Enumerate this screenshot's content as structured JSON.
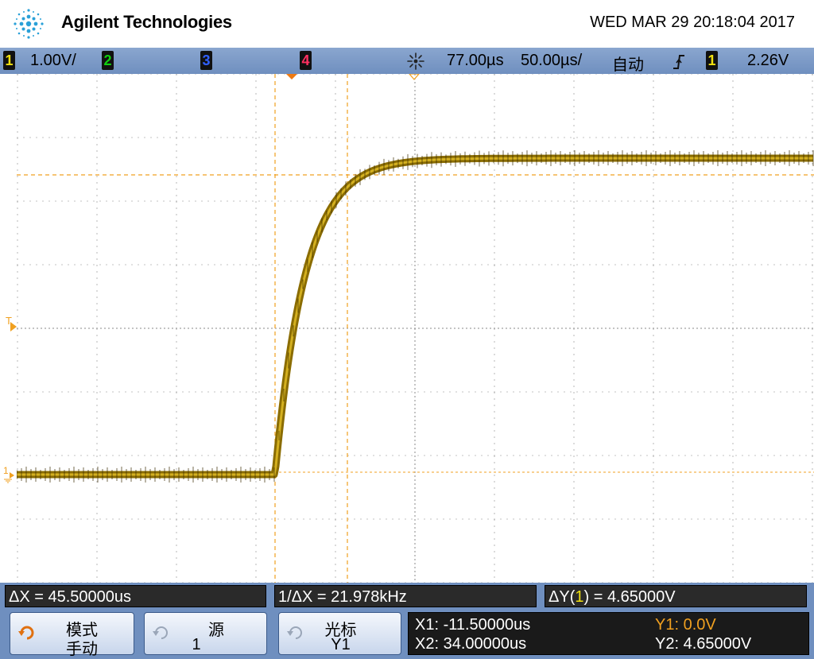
{
  "header": {
    "brand": "Agilent Technologies",
    "datetime": "WED MAR 29 20:18:04 2017",
    "logo_icon": "agilent-spark-logo"
  },
  "topbar": {
    "ch1": {
      "num": "1",
      "scale": "1.00V/",
      "color": "#f0e010"
    },
    "ch2": {
      "num": "2",
      "color": "#10d010"
    },
    "ch3": {
      "num": "3",
      "color": "#3060ff"
    },
    "ch4": {
      "num": "4",
      "color": "#ff3060"
    },
    "timebase_icon": "timebase-spark-icon",
    "delay": "77.00µs",
    "timescale": "50.00µs/",
    "mode": "自动",
    "trigger_icon": "rising-edge-icon",
    "trig_source": "1",
    "trig_level": "2.26V"
  },
  "screen": {
    "trigger_marker": "T",
    "ground_marker": "1",
    "trace_color": "#8a6c00",
    "grid_color": "#888888",
    "cursor_color": "#f0a020"
  },
  "measurements": {
    "dx": "ΔX = 45.50000us",
    "inv_dx": "1/ΔX = 21.978kHz",
    "dy_prefix": "ΔY(",
    "dy_ch": "1",
    "dy_suffix": ") = 4.65000V"
  },
  "softkeys": {
    "mode": {
      "line1": "模式",
      "line2": "手动",
      "icon": "rotate-knob-icon"
    },
    "source": {
      "line1": "源",
      "line2": "1",
      "icon": "rotate-knob-icon"
    },
    "cursor": {
      "line1": "光标",
      "line2": "Y1",
      "icon": "rotate-knob-icon"
    },
    "readout": {
      "x1": "X1: -11.50000us",
      "x2": "X2: 34.00000us",
      "y1": "Y1: 0.0V",
      "y2": "Y2: 4.65000V"
    }
  }
}
